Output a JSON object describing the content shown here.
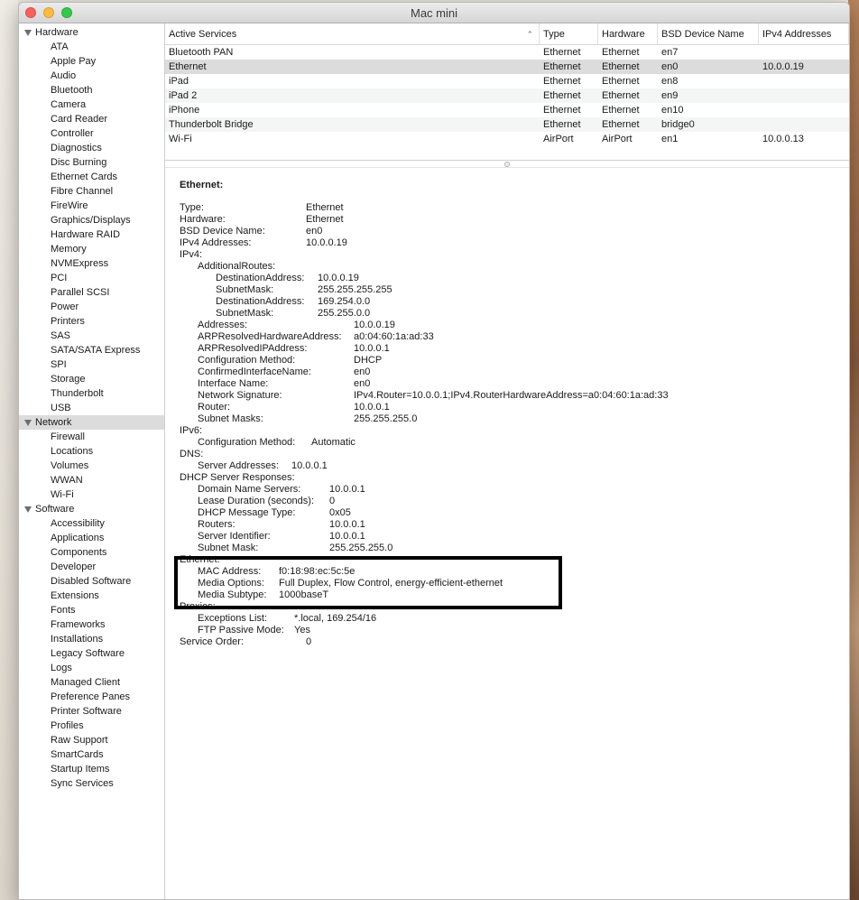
{
  "window": {
    "title": "Mac mini"
  },
  "sidebar": {
    "groups": [
      {
        "label": "Hardware",
        "items": [
          "ATA",
          "Apple Pay",
          "Audio",
          "Bluetooth",
          "Camera",
          "Card Reader",
          "Controller",
          "Diagnostics",
          "Disc Burning",
          "Ethernet Cards",
          "Fibre Channel",
          "FireWire",
          "Graphics/Displays",
          "Hardware RAID",
          "Memory",
          "NVMExpress",
          "PCI",
          "Parallel SCSI",
          "Power",
          "Printers",
          "SAS",
          "SATA/SATA Express",
          "SPI",
          "Storage",
          "Thunderbolt",
          "USB"
        ]
      },
      {
        "label": "Network",
        "selected": true,
        "items": [
          "Firewall",
          "Locations",
          "Volumes",
          "WWAN",
          "Wi-Fi"
        ]
      },
      {
        "label": "Software",
        "items": [
          "Accessibility",
          "Applications",
          "Components",
          "Developer",
          "Disabled Software",
          "Extensions",
          "Fonts",
          "Frameworks",
          "Installations",
          "Legacy Software",
          "Logs",
          "Managed Client",
          "Preference Panes",
          "Printer Software",
          "Profiles",
          "Raw Support",
          "SmartCards",
          "Startup Items",
          "Sync Services"
        ]
      }
    ]
  },
  "table": {
    "headers": [
      "Active Services",
      "Type",
      "Hardware",
      "BSD Device Name",
      "IPv4 Addresses"
    ],
    "rows": [
      [
        "Bluetooth PAN",
        "Ethernet",
        "Ethernet",
        "en7",
        ""
      ],
      [
        "Ethernet",
        "Ethernet",
        "Ethernet",
        "en0",
        "10.0.0.19"
      ],
      [
        "iPad",
        "Ethernet",
        "Ethernet",
        "en8",
        ""
      ],
      [
        "iPad 2",
        "Ethernet",
        "Ethernet",
        "en9",
        ""
      ],
      [
        "iPhone",
        "Ethernet",
        "Ethernet",
        "en10",
        ""
      ],
      [
        "Thunderbolt Bridge",
        "Ethernet",
        "Ethernet",
        "bridge0",
        ""
      ],
      [
        "Wi-Fi",
        "AirPort",
        "AirPort",
        "en1",
        "10.0.0.13"
      ]
    ],
    "selected_row": 1
  },
  "detail": {
    "title": "Ethernet:",
    "lines": [
      {
        "k": "Type:",
        "v": "Ethernet",
        "indent": 0,
        "vcol": 1
      },
      {
        "k": "Hardware:",
        "v": "Ethernet",
        "indent": 0,
        "vcol": 1
      },
      {
        "k": "BSD Device Name:",
        "v": "en0",
        "indent": 0,
        "vcol": 1
      },
      {
        "k": "IPv4 Addresses:",
        "v": "10.0.0.19",
        "indent": 0,
        "vcol": 1
      },
      {
        "k": "IPv4:",
        "v": "",
        "indent": 0,
        "vcol": 0
      },
      {
        "k": "AdditionalRoutes:",
        "v": "",
        "indent": 1,
        "vcol": 0
      },
      {
        "k": "DestinationAddress:",
        "v": "10.0.0.19",
        "indent": 2,
        "vcol": 2
      },
      {
        "k": "SubnetMask:",
        "v": "255.255.255.255",
        "indent": 2,
        "vcol": 2
      },
      {
        "k": "DestinationAddress:",
        "v": "169.254.0.0",
        "indent": 2,
        "vcol": 2
      },
      {
        "k": "SubnetMask:",
        "v": "255.255.0.0",
        "indent": 2,
        "vcol": 2
      },
      {
        "k": "Addresses:",
        "v": "10.0.0.19",
        "indent": 1,
        "vcol": 3
      },
      {
        "k": "ARPResolvedHardwareAddress:",
        "v": "a0:04:60:1a:ad:33",
        "indent": 1,
        "vcol": 3
      },
      {
        "k": "ARPResolvedIPAddress:",
        "v": "10.0.0.1",
        "indent": 1,
        "vcol": 3
      },
      {
        "k": "Configuration Method:",
        "v": "DHCP",
        "indent": 1,
        "vcol": 3
      },
      {
        "k": "ConfirmedInterfaceName:",
        "v": "en0",
        "indent": 1,
        "vcol": 3
      },
      {
        "k": "Interface Name:",
        "v": "en0",
        "indent": 1,
        "vcol": 3
      },
      {
        "k": "Network Signature:",
        "v": "IPv4.Router=10.0.0.1;IPv4.RouterHardwareAddress=a0:04:60:1a:ad:33",
        "indent": 1,
        "vcol": 3
      },
      {
        "k": "Router:",
        "v": "10.0.0.1",
        "indent": 1,
        "vcol": 3
      },
      {
        "k": "Subnet Masks:",
        "v": "255.255.255.0",
        "indent": 1,
        "vcol": 3
      },
      {
        "k": "IPv6:",
        "v": "",
        "indent": 0,
        "vcol": 0
      },
      {
        "k": "Configuration Method:",
        "v": "Automatic",
        "indent": 1,
        "vcol": 4
      },
      {
        "k": "DNS:",
        "v": "",
        "indent": 0,
        "vcol": 0
      },
      {
        "k": "Server Addresses:",
        "v": "10.0.0.1",
        "indent": 1,
        "vcol": 5
      },
      {
        "k": "DHCP Server Responses:",
        "v": "",
        "indent": 0,
        "vcol": 0
      },
      {
        "k": "Domain Name Servers:",
        "v": "10.0.0.1",
        "indent": 1,
        "vcol": 6
      },
      {
        "k": "Lease Duration (seconds):",
        "v": "0",
        "indent": 1,
        "vcol": 6
      },
      {
        "k": "DHCP Message Type:",
        "v": "0x05",
        "indent": 1,
        "vcol": 6
      },
      {
        "k": "Routers:",
        "v": "10.0.0.1",
        "indent": 1,
        "vcol": 6
      },
      {
        "k": "Server Identifier:",
        "v": "10.0.0.1",
        "indent": 1,
        "vcol": 6
      },
      {
        "k": "Subnet Mask:",
        "v": "255.255.255.0",
        "indent": 1,
        "vcol": 6
      },
      {
        "k": "Ethernet:",
        "v": "",
        "indent": 0,
        "vcol": 0
      },
      {
        "k": "MAC Address:",
        "v": "f0:18:98:ec:5c:5e",
        "indent": 1,
        "vcol": 7
      },
      {
        "k": "Media Options:",
        "v": "Full Duplex, Flow Control, energy-efficient-ethernet",
        "indent": 1,
        "vcol": 7
      },
      {
        "k": "Media Subtype:",
        "v": "1000baseT",
        "indent": 1,
        "vcol": 7
      },
      {
        "k": "Proxies:",
        "v": "",
        "indent": 0,
        "vcol": 0
      },
      {
        "k": "Exceptions List:",
        "v": "*.local, 169.254/16",
        "indent": 1,
        "vcol": 8
      },
      {
        "k": "FTP Passive Mode:",
        "v": "Yes",
        "indent": 1,
        "vcol": 8
      },
      {
        "k": "Service Order:",
        "v": "0",
        "indent": 0,
        "vcol": 9
      }
    ]
  }
}
